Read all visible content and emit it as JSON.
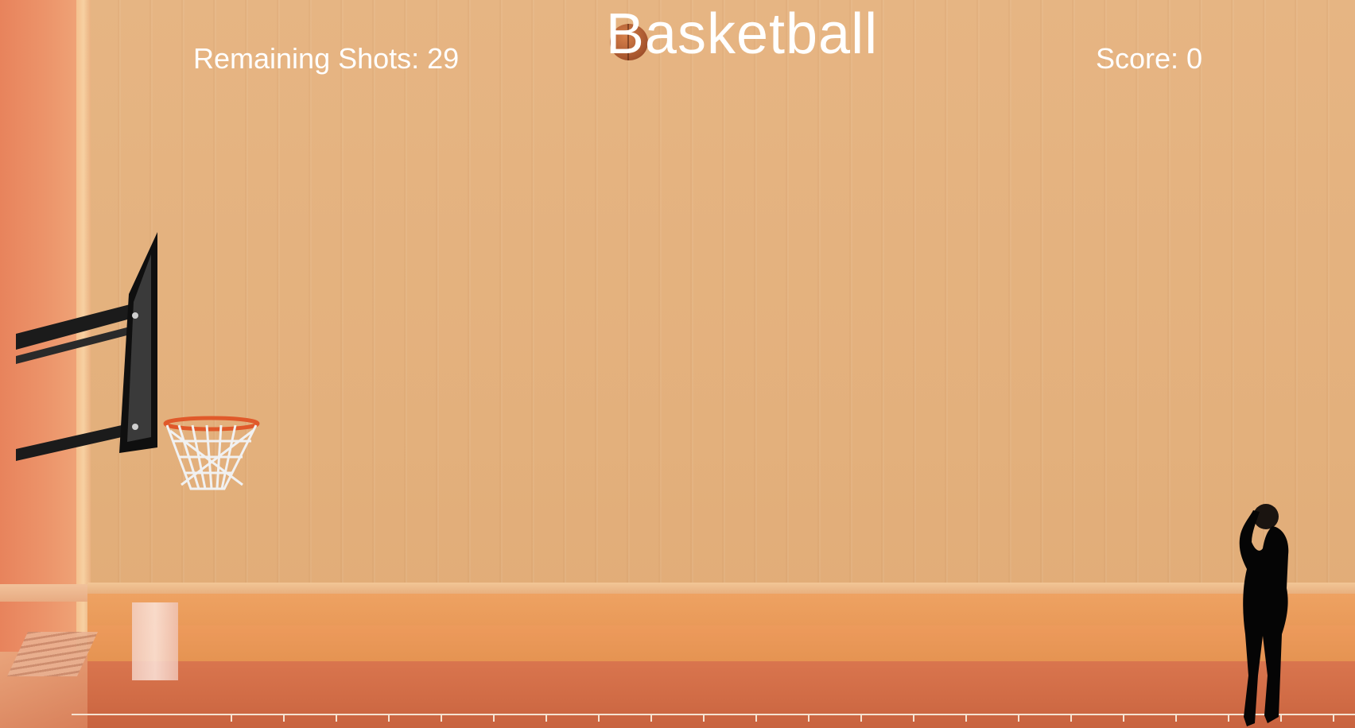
{
  "game": {
    "title": "Basketball",
    "remaining_shots_label": "Remaining Shots: 29",
    "score_label": "Score: 0"
  },
  "icons": {
    "ball": "basketball-icon",
    "hoop": "basketball-hoop-icon",
    "player": "player-silhouette-icon"
  },
  "colors": {
    "wall": "#e3b07c",
    "floor": "#d06b45",
    "text": "#ffffff",
    "rim": "#e0592a"
  }
}
